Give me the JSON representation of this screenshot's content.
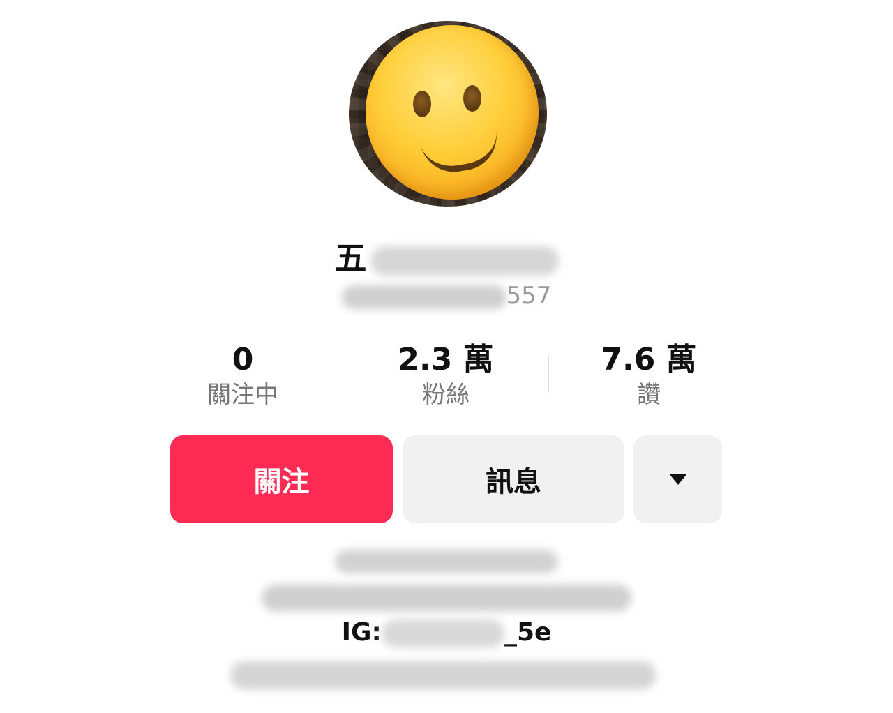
{
  "profile": {
    "display_name_visible": "五",
    "handle_visible_suffix": "557",
    "avatar_icon": "slightly-smiling-face-icon",
    "bio_ig_prefix": "IG:",
    "bio_ig_suffix": "_5e"
  },
  "stats": [
    {
      "value": "0",
      "label": "關注中"
    },
    {
      "value": "2.3 萬",
      "label": "粉絲"
    },
    {
      "value": "7.6 萬",
      "label": "讚"
    }
  ],
  "buttons": {
    "follow_label": "關注",
    "message_label": "訊息",
    "more_icon": "caret-down-icon"
  },
  "colors": {
    "follow_bg": "#fe2c55",
    "secondary_bg": "#f1f1f2",
    "label_gray": "#777777"
  }
}
